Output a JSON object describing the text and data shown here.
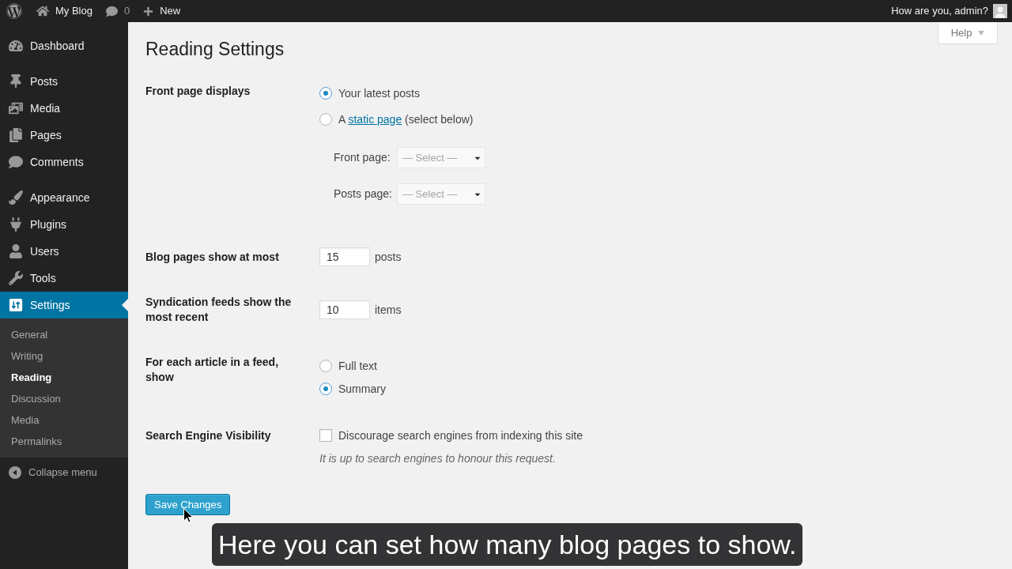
{
  "admin_bar": {
    "site_name": "My Blog",
    "comments_count": "0",
    "new_label": "New",
    "greeting": "How are you, admin?"
  },
  "sidebar": {
    "menu_groups": [
      [
        {
          "label": "Dashboard",
          "selected": false
        }
      ],
      [
        {
          "label": "Posts",
          "selected": false
        },
        {
          "label": "Media",
          "selected": false
        },
        {
          "label": "Pages",
          "selected": false
        },
        {
          "label": "Comments",
          "selected": false
        }
      ],
      [
        {
          "label": "Appearance",
          "selected": false
        },
        {
          "label": "Plugins",
          "selected": false
        },
        {
          "label": "Users",
          "selected": false
        },
        {
          "label": "Tools",
          "selected": false
        },
        {
          "label": "Settings",
          "selected": true
        }
      ]
    ],
    "submenu": [
      {
        "label": "General",
        "selected": false
      },
      {
        "label": "Writing",
        "selected": false
      },
      {
        "label": "Reading",
        "selected": true
      },
      {
        "label": "Discussion",
        "selected": false
      },
      {
        "label": "Media",
        "selected": false
      },
      {
        "label": "Permalinks",
        "selected": false
      }
    ],
    "collapse_label": "Collapse menu"
  },
  "help_tab": {
    "label": "Help"
  },
  "page_title": "Reading Settings",
  "settings": [
    {
      "kind": "front_page",
      "label": "Front page displays",
      "options": [
        {
          "text": "Your latest posts",
          "selected": true
        },
        {
          "prefix": "A",
          "link": "static page",
          "suffix": "(select below)",
          "selected": false
        }
      ],
      "selects": [
        {
          "label": "Front page:",
          "value": "— Select —",
          "disabled": true
        },
        {
          "label": "Posts page:",
          "value": "— Select —",
          "disabled": true
        }
      ]
    },
    {
      "kind": "number",
      "label": "Blog pages show at most",
      "value": "15",
      "unit": "posts"
    },
    {
      "kind": "number",
      "label": "Syndication feeds show the most recent",
      "value": "10",
      "unit": "items"
    },
    {
      "kind": "radio",
      "label": "For each article in a feed, show",
      "options": [
        {
          "text": "Full text",
          "selected": false
        },
        {
          "text": "Summary",
          "selected": true
        }
      ]
    },
    {
      "kind": "checkbox",
      "label": "Search Engine Visibility",
      "text": "Discourage search engines from indexing this site",
      "checked": false,
      "description": "It is up to search engines to honour this request."
    }
  ],
  "save_button": "Save Changes",
  "caption": "Here you can set how many blog pages to show."
}
